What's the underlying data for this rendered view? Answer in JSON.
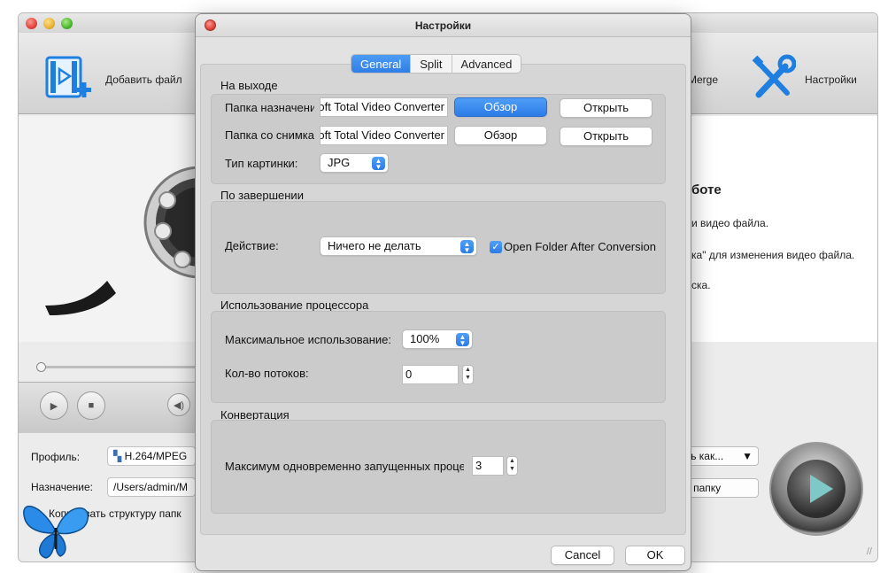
{
  "main_window": {
    "toolbar": {
      "add_file_label": "Добавить файл",
      "merge_label": "Merge",
      "settings_label": "Настройки"
    },
    "right_panel": {
      "heading_fragment": "боте",
      "line1": "и видео файла.",
      "line2": "ка\" для изменения видео файла.",
      "line3": "ска."
    },
    "bottom": {
      "profile_label": "Профиль:",
      "profile_value": "H.264/MPEG",
      "destination_label": "Назначение:",
      "destination_value": "/Users/admin/M",
      "copy_structure_label": "Копировать структуру папк",
      "save_as_label": "ить как...",
      "open_folder_label": "ть папку"
    }
  },
  "dialog": {
    "title": "Настройки",
    "tabs": [
      {
        "label": "General",
        "active": true
      },
      {
        "label": "Split",
        "active": false
      },
      {
        "label": "Advanced",
        "active": false
      }
    ],
    "output": {
      "title": "На выходе",
      "dest_folder_label": "Папка назначения:",
      "dest_folder_value": "oft Total Video Converter",
      "dest_browse": "Обзор",
      "dest_open": "Открыть",
      "snap_folder_label": "Папка со снимками:",
      "snap_folder_value": "oft Total Video Converter",
      "snap_browse": "Обзор",
      "snap_open": "Открыть",
      "image_type_label": "Тип картинки:",
      "image_type_value": "JPG"
    },
    "completion": {
      "title": "По завершении",
      "action_label": "Действие:",
      "action_value": "Ничего не делать",
      "open_folder_checkbox": "Open Folder After Conversion",
      "open_folder_checked": true
    },
    "cpu": {
      "title": "Использование процессора",
      "max_usage_label": "Максимальное использование:",
      "max_usage_value": "100%",
      "threads_label": "Кол-во потоков:",
      "threads_value": "0"
    },
    "conversion": {
      "title": "Конвертация",
      "max_tasks_label": "Максимум одновременно запущенных процессов:",
      "max_tasks_value": "3"
    },
    "footer": {
      "cancel": "Cancel",
      "ok": "OK"
    }
  }
}
